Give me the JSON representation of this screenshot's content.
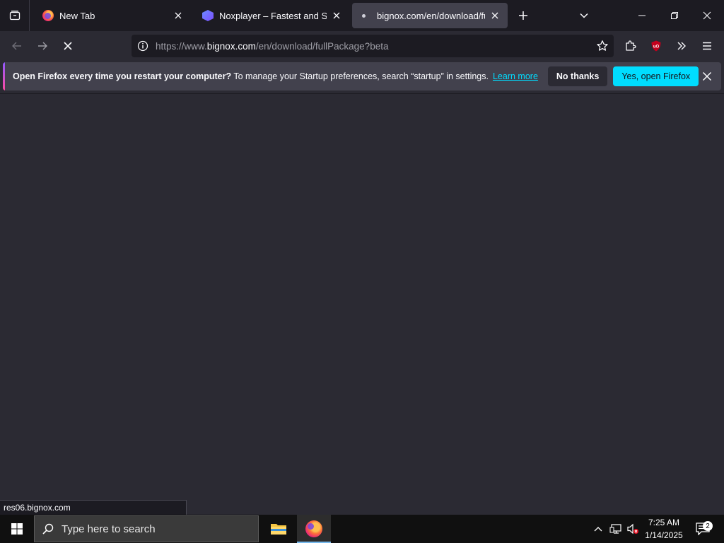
{
  "tabs": [
    {
      "title": "New Tab",
      "icon": "firefox-icon",
      "active": false
    },
    {
      "title": "Noxplayer – Fastest and Smoot",
      "icon": "noxplayer-icon",
      "active": false
    },
    {
      "title": "bignox.com/en/download/fullI",
      "icon": "loading-dot-icon",
      "active": true
    }
  ],
  "urlbar": {
    "prefix": "https://www.",
    "host": "bignox.com",
    "path": "/en/download/fullPackage?beta"
  },
  "notification": {
    "bold": "Open Firefox every time you restart your computer?",
    "text": " To manage your Startup preferences, search “startup” in settings.",
    "learn_more": "Learn more",
    "no_thanks": "No thanks",
    "yes": "Yes, open Firefox"
  },
  "status_text": "res06.bignox.com",
  "taskbar": {
    "search_placeholder": "Type here to search",
    "time": "7:25 AM",
    "date": "1/14/2025",
    "notification_count": "2"
  },
  "colors": {
    "accent": "#00ddff",
    "toolbar": "#2b2a33",
    "tabstrip": "#1c1b22",
    "active_tab": "#42414d"
  }
}
